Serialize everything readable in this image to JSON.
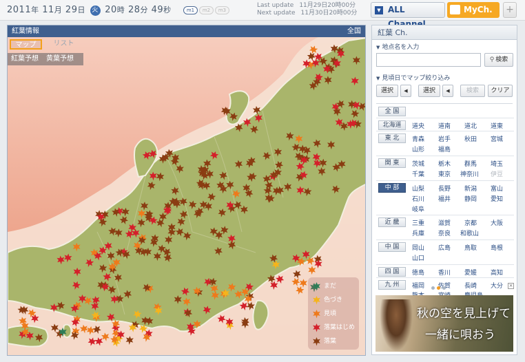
{
  "clock": {
    "year": "2011",
    "year_unit": "年",
    "month": "11",
    "month_unit": "月",
    "day": "29",
    "day_unit": "日",
    "weekday": "火",
    "hour": "20",
    "hour_unit": "時",
    "minute": "28",
    "minute_unit": "分",
    "second": "49",
    "second_unit": "秒"
  },
  "mode_pills": [
    "m1",
    "m2",
    "m3"
  ],
  "updates": {
    "last_label": "Last update",
    "last_value": "11月29日20時00分",
    "next_label": "Next update",
    "next_value": "11月30日20時00分"
  },
  "tabs": {
    "all_channel": "ALL Channel",
    "my_ch": "MyCh.",
    "plus": "+"
  },
  "map": {
    "header_title": "紅葉情報",
    "header_region": "全国",
    "view_tabs": {
      "map": "マップ",
      "list": "リスト"
    },
    "forecast": {
      "koyo": "紅葉予想",
      "ouyo": "黄葉予想"
    },
    "legend": [
      {
        "label": "まだ",
        "color": "#2e7d57"
      },
      {
        "label": "色づき",
        "color": "#f5b41c"
      },
      {
        "label": "見頃",
        "color": "#ee7a1c"
      },
      {
        "label": "落葉はじめ",
        "color": "#d4202a"
      },
      {
        "label": "落葉",
        "color": "#8a3d12"
      }
    ],
    "colors": {
      "sea_top": "#f7cfc0",
      "sea_bottom": "#e88d6f",
      "land": "#a9b56b",
      "land_edge": "#f2efe0"
    }
  },
  "side": {
    "title": "紅葉 Ch.",
    "search_label": "地点名を入力",
    "search_input_value": "",
    "search_button": "検索",
    "filter_label": "見頃日でマップ絞り込み",
    "filter_select1": "選択",
    "filter_arrow": "◀",
    "filter_select2": "選択",
    "filter_search": "検索",
    "filter_clear": "クリア",
    "regions": [
      {
        "name": "全 国",
        "prefs": []
      },
      {
        "name": "北海道",
        "prefs": [
          "道央",
          "道南",
          "道北",
          "道東"
        ]
      },
      {
        "name": "東 北",
        "prefs": [
          "青森",
          "岩手",
          "秋田",
          "宮城",
          "山形",
          "福島"
        ]
      },
      {
        "name": "関 東",
        "prefs": [
          "茨城",
          "栃木",
          "群馬",
          "埼玉",
          "千葉",
          "東京",
          "神奈川",
          "伊豆"
        ]
      },
      {
        "name": "中 部",
        "prefs": [
          "山梨",
          "長野",
          "新潟",
          "富山",
          "石川",
          "福井",
          "静岡",
          "愛知",
          "岐阜"
        ]
      },
      {
        "name": "近 畿",
        "prefs": [
          "三重",
          "滋賀",
          "京都",
          "大阪",
          "兵庫",
          "奈良",
          "和歌山"
        ]
      },
      {
        "name": "中 国",
        "prefs": [
          "岡山",
          "広島",
          "鳥取",
          "島根",
          "山口"
        ]
      },
      {
        "name": "四 国",
        "prefs": [
          "徳島",
          "香川",
          "愛媛",
          "高知"
        ]
      },
      {
        "name": "九 州",
        "prefs": [
          "福岡",
          "佐賀",
          "長崎",
          "大分",
          "熊本",
          "宮崎",
          "鹿児島"
        ]
      }
    ],
    "banner": {
      "line1": "秋の空を見上げて",
      "line2": "一緒に唄おう"
    }
  }
}
